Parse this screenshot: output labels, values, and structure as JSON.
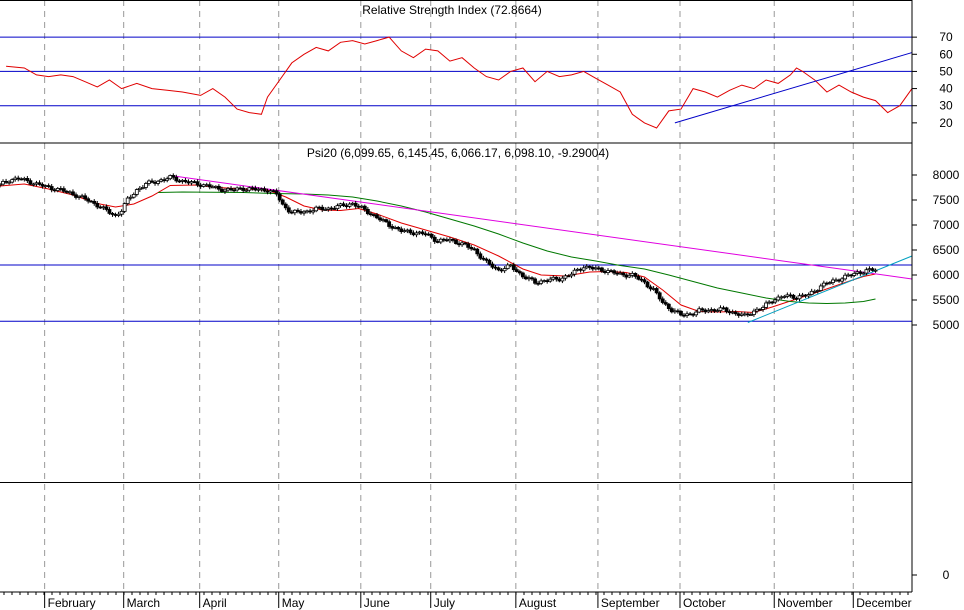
{
  "colors": {
    "background": "#ffffff",
    "frame": "#000000",
    "gridline": "#999999",
    "rsi_line": "#e00000",
    "rsi_level": "#0000c8",
    "rsi_trend": "#0000c8",
    "ma_short": "#e00000",
    "ma_long": "#007800",
    "resistance": "#e000e0",
    "support": "#00a0c0",
    "price_level": "#0000c8",
    "candle_up": "#ffffff",
    "candle_down": "#000000"
  },
  "chart_data": [
    {
      "type": "line",
      "title": "Relative Strength Index (72.8664)",
      "ylim": [
        10,
        80
      ],
      "yticks": [
        "20",
        "30",
        "40",
        "50",
        "60",
        "70"
      ],
      "ytick_values": [
        20,
        30,
        40,
        50,
        60,
        70
      ],
      "levels": [
        30,
        50,
        70
      ],
      "x_range": [
        0,
        300
      ],
      "series": [
        {
          "values": [
            [
              2,
              53
            ],
            [
              8,
              52
            ],
            [
              12,
              48
            ],
            [
              16,
              47
            ],
            [
              20,
              48
            ],
            [
              24,
              47
            ],
            [
              28,
              44
            ],
            [
              32,
              41
            ],
            [
              36,
              45
            ],
            [
              40,
              40
            ],
            [
              45,
              43
            ],
            [
              50,
              40
            ],
            [
              55,
              39
            ],
            [
              60,
              38
            ],
            [
              66,
              36
            ],
            [
              70,
              40
            ],
            [
              74,
              35
            ],
            [
              78,
              28
            ],
            [
              82,
              26
            ],
            [
              86,
              25
            ],
            [
              88,
              35
            ],
            [
              92,
              45
            ],
            [
              96,
              55
            ],
            [
              100,
              60
            ],
            [
              104,
              64
            ],
            [
              108,
              62
            ],
            [
              112,
              67
            ],
            [
              116,
              68
            ],
            [
              120,
              66
            ],
            [
              124,
              68
            ],
            [
              128,
              70
            ],
            [
              132,
              62
            ],
            [
              136,
              58
            ],
            [
              140,
              63
            ],
            [
              144,
              62
            ],
            [
              148,
              56
            ],
            [
              152,
              58
            ],
            [
              156,
              52
            ],
            [
              160,
              47
            ],
            [
              164,
              45
            ],
            [
              168,
              50
            ],
            [
              172,
              52
            ],
            [
              176,
              44
            ],
            [
              180,
              50
            ],
            [
              184,
              47
            ],
            [
              188,
              48
            ],
            [
              192,
              50
            ],
            [
              196,
              46
            ],
            [
              200,
              42
            ],
            [
              204,
              38
            ],
            [
              208,
              25
            ],
            [
              212,
              20
            ],
            [
              216,
              17
            ],
            [
              220,
              27
            ],
            [
              224,
              28
            ],
            [
              228,
              40
            ],
            [
              232,
              38
            ],
            [
              236,
              35
            ],
            [
              240,
              39
            ],
            [
              244,
              42
            ],
            [
              248,
              40
            ],
            [
              252,
              45
            ],
            [
              256,
              43
            ],
            [
              260,
              48
            ],
            [
              262,
              52
            ],
            [
              264,
              50
            ],
            [
              268,
              45
            ],
            [
              272,
              38
            ],
            [
              276,
              42
            ],
            [
              280,
              38
            ],
            [
              284,
              35
            ],
            [
              288,
              33
            ],
            [
              292,
              26
            ],
            [
              296,
              30
            ],
            [
              300,
              40
            ]
          ]
        },
        {
          "values": []
        }
      ],
      "trendline": [
        [
          222,
          20
        ],
        [
          300,
          61
        ]
      ]
    },
    {
      "type": "candlestick",
      "title": "Psi20 (6,099.65, 6,145.45, 6,066.17, 6,098.10, -9.29004)",
      "ylim": [
        -300,
        8300
      ],
      "yticks": [
        "0",
        "5000",
        "5500",
        "6000",
        "6500",
        "7000",
        "7500",
        "8000"
      ],
      "ytick_values": [
        0,
        5000,
        5500,
        6000,
        6500,
        7000,
        7500,
        8000
      ],
      "x_range": [
        0,
        300
      ],
      "categories": [
        "February",
        "March",
        "April",
        "May",
        "June",
        "July",
        "August",
        "September",
        "October",
        "November",
        "December"
      ],
      "category_x": [
        16,
        42,
        67,
        93,
        120,
        143,
        171,
        198,
        225,
        256,
        282
      ],
      "price_levels": [
        6200,
        5075,
        1850
      ],
      "resistance_line": [
        [
          56,
          7990
        ],
        [
          300,
          5920
        ]
      ],
      "support_line": [
        [
          246,
          5050
        ],
        [
          300,
          6380
        ]
      ],
      "close_path": [
        [
          0,
          7800
        ],
        [
          3,
          7900
        ],
        [
          6,
          7930
        ],
        [
          9,
          7880
        ],
        [
          12,
          7820
        ],
        [
          16,
          7750
        ],
        [
          20,
          7700
        ],
        [
          24,
          7620
        ],
        [
          28,
          7520
        ],
        [
          32,
          7400
        ],
        [
          36,
          7250
        ],
        [
          38,
          7180
        ],
        [
          40,
          7300
        ],
        [
          42,
          7500
        ],
        [
          45,
          7700
        ],
        [
          48,
          7820
        ],
        [
          52,
          7880
        ],
        [
          56,
          7950
        ],
        [
          60,
          7880
        ],
        [
          64,
          7830
        ],
        [
          68,
          7790
        ],
        [
          72,
          7720
        ],
        [
          76,
          7700
        ],
        [
          80,
          7730
        ],
        [
          84,
          7710
        ],
        [
          88,
          7700
        ],
        [
          91,
          7620
        ],
        [
          93,
          7400
        ],
        [
          96,
          7250
        ],
        [
          100,
          7260
        ],
        [
          104,
          7320
        ],
        [
          108,
          7330
        ],
        [
          112,
          7380
        ],
        [
          116,
          7430
        ],
        [
          120,
          7300
        ],
        [
          124,
          7150
        ],
        [
          128,
          7000
        ],
        [
          132,
          6880
        ],
        [
          136,
          6850
        ],
        [
          140,
          6820
        ],
        [
          144,
          6680
        ],
        [
          148,
          6700
        ],
        [
          152,
          6620
        ],
        [
          156,
          6500
        ],
        [
          160,
          6250
        ],
        [
          164,
          6100
        ],
        [
          168,
          6180
        ],
        [
          172,
          5980
        ],
        [
          176,
          5850
        ],
        [
          180,
          5900
        ],
        [
          184,
          5920
        ],
        [
          188,
          6020
        ],
        [
          192,
          6170
        ],
        [
          196,
          6120
        ],
        [
          200,
          6080
        ],
        [
          204,
          6010
        ],
        [
          208,
          6000
        ],
        [
          212,
          5850
        ],
        [
          215,
          5700
        ],
        [
          218,
          5450
        ],
        [
          221,
          5300
        ],
        [
          224,
          5200
        ],
        [
          227,
          5220
        ],
        [
          230,
          5280
        ],
        [
          234,
          5300
        ],
        [
          238,
          5310
        ],
        [
          242,
          5230
        ],
        [
          245,
          5180
        ],
        [
          248,
          5280
        ],
        [
          251,
          5350
        ],
        [
          254,
          5500
        ],
        [
          258,
          5580
        ],
        [
          262,
          5560
        ],
        [
          266,
          5600
        ],
        [
          270,
          5780
        ],
        [
          274,
          5880
        ],
        [
          278,
          5960
        ],
        [
          282,
          6050
        ],
        [
          285,
          6080
        ],
        [
          288,
          6110
        ]
      ],
      "series": [
        {
          "values": [
            [
              0,
              7780
            ],
            [
              8,
              7820
            ],
            [
              16,
              7720
            ],
            [
              24,
              7600
            ],
            [
              32,
              7430
            ],
            [
              38,
              7360
            ],
            [
              44,
              7420
            ],
            [
              50,
              7580
            ],
            [
              56,
              7790
            ],
            [
              64,
              7800
            ],
            [
              72,
              7750
            ],
            [
              80,
              7720
            ],
            [
              88,
              7700
            ],
            [
              94,
              7560
            ],
            [
              100,
              7380
            ],
            [
              106,
              7300
            ],
            [
              112,
              7290
            ],
            [
              118,
              7330
            ],
            [
              124,
              7220
            ],
            [
              132,
              7040
            ],
            [
              140,
              6900
            ],
            [
              148,
              6760
            ],
            [
              156,
              6600
            ],
            [
              164,
              6380
            ],
            [
              172,
              6120
            ],
            [
              178,
              6000
            ],
            [
              186,
              5980
            ],
            [
              194,
              6060
            ],
            [
              200,
              6070
            ],
            [
              206,
              6050
            ],
            [
              212,
              5960
            ],
            [
              218,
              5700
            ],
            [
              224,
              5400
            ],
            [
              230,
              5270
            ],
            [
              236,
              5260
            ],
            [
              242,
              5270
            ],
            [
              248,
              5250
            ],
            [
              254,
              5360
            ],
            [
              262,
              5520
            ],
            [
              270,
              5680
            ],
            [
              278,
              5850
            ],
            [
              284,
              5970
            ],
            [
              288,
              6020
            ]
          ]
        },
        {
          "values": [
            [
              52,
              7650
            ],
            [
              60,
              7660
            ],
            [
              70,
              7655
            ],
            [
              80,
              7650
            ],
            [
              90,
              7630
            ],
            [
              100,
              7620
            ],
            [
              108,
              7600
            ],
            [
              116,
              7560
            ],
            [
              124,
              7480
            ],
            [
              132,
              7380
            ],
            [
              140,
              7260
            ],
            [
              148,
              7120
            ],
            [
              156,
              6980
            ],
            [
              164,
              6820
            ],
            [
              172,
              6640
            ],
            [
              180,
              6480
            ],
            [
              188,
              6360
            ],
            [
              196,
              6280
            ],
            [
              204,
              6190
            ],
            [
              212,
              6120
            ],
            [
              220,
              6000
            ],
            [
              228,
              5870
            ],
            [
              236,
              5740
            ],
            [
              244,
              5640
            ],
            [
              252,
              5540
            ],
            [
              260,
              5470
            ],
            [
              266,
              5440
            ],
            [
              272,
              5430
            ],
            [
              278,
              5440
            ],
            [
              284,
              5470
            ],
            [
              288,
              5520
            ]
          ]
        }
      ]
    }
  ]
}
